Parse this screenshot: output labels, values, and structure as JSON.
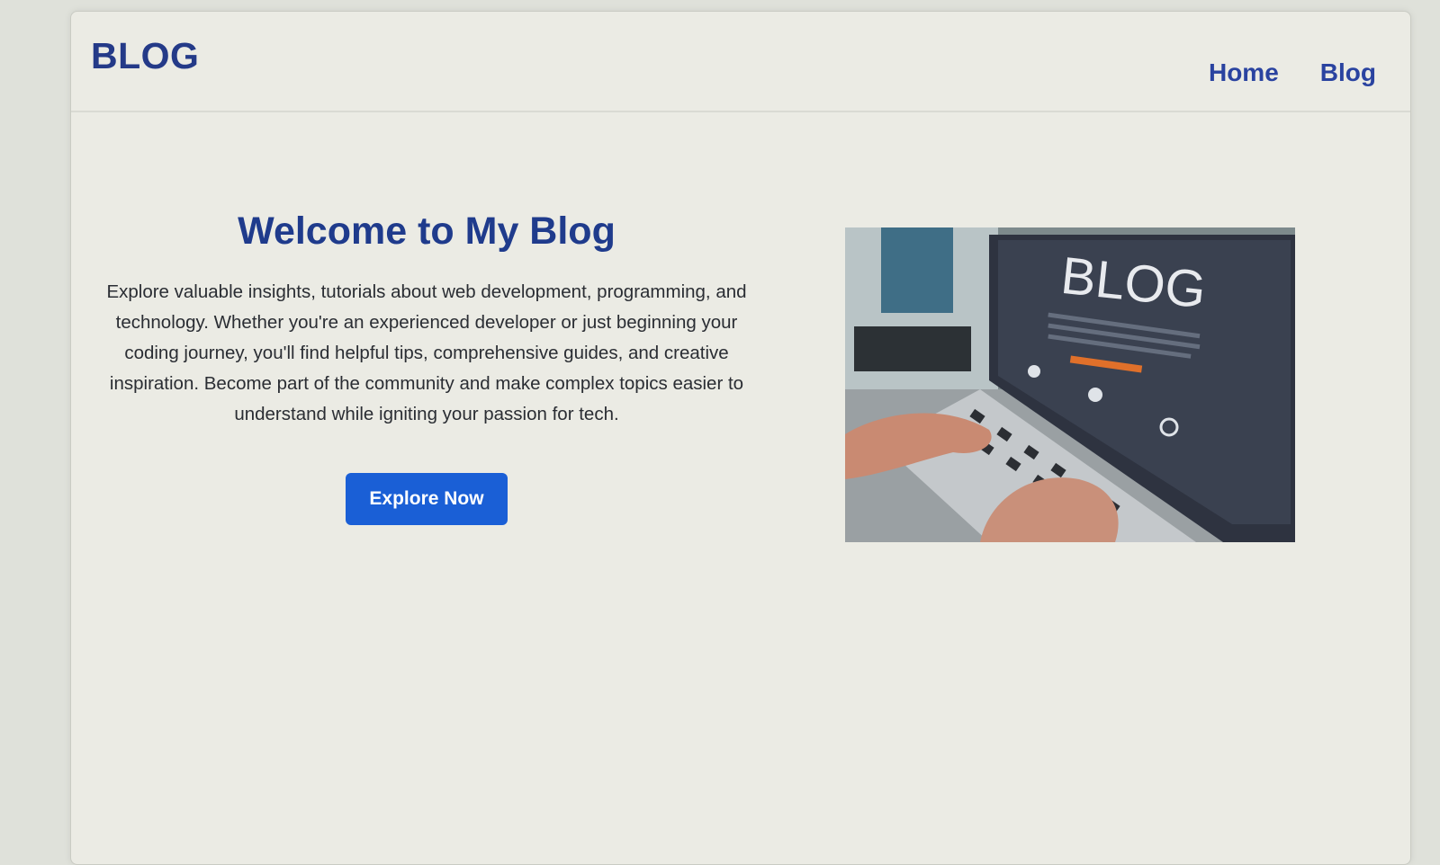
{
  "navbar": {
    "logo": "BLOG",
    "links": [
      {
        "label": "Home"
      },
      {
        "label": "Blog"
      }
    ]
  },
  "hero": {
    "title": "Welcome to My Blog",
    "description": "Explore valuable insights, tutorials about web development, programming, and technology. Whether you're an experienced developer or just beginning your coding journey, you'll find helpful tips, comprehensive guides, and creative inspiration. Become part of the community and make complex topics easier to understand while igniting your passion for tech.",
    "button_label": "Explore Now",
    "image": {
      "screen_text": "BLOG",
      "icon": "laptop-blog-photo"
    }
  },
  "colors": {
    "brand": "#243a88",
    "button": "#1a5fd6",
    "background": "#ebebe4"
  }
}
